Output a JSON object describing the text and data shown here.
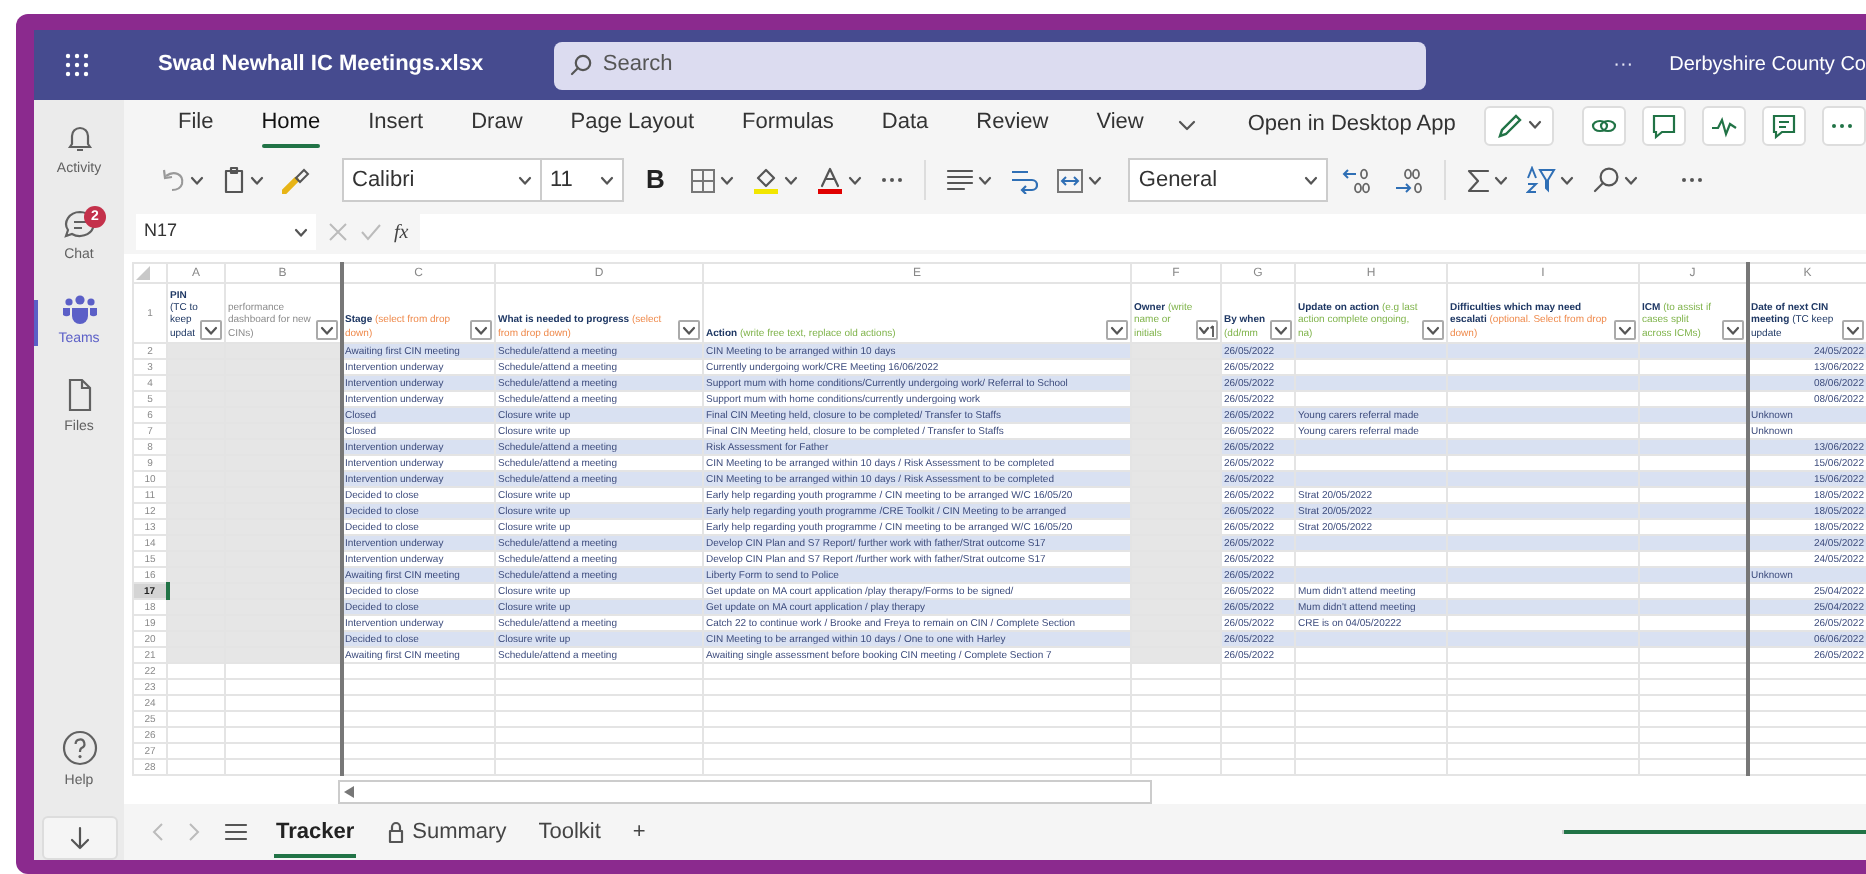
{
  "window": {
    "title": "Swad Newhall IC Meetings.xlsx",
    "search_placeholder": "Search",
    "more": "···",
    "organization": "Derbyshire County Co"
  },
  "rail": [
    {
      "label": "Activity",
      "selected": false
    },
    {
      "label": "Chat",
      "badge": "2",
      "selected": false
    },
    {
      "label": "Teams",
      "selected": true
    },
    {
      "label": "Files",
      "selected": false
    }
  ],
  "rail_bottom": [
    {
      "label": "Help"
    }
  ],
  "header_row": "1",
  "ribbon": {
    "tabs": [
      {
        "label": "File",
        "selected": false
      },
      {
        "label": "Home",
        "selected": true
      },
      {
        "label": "Insert",
        "selected": false
      },
      {
        "label": "Draw",
        "selected": false
      },
      {
        "label": "Page Layout",
        "selected": false
      },
      {
        "label": "Formulas",
        "selected": false
      },
      {
        "label": "Data",
        "selected": false
      },
      {
        "label": "Review",
        "selected": false
      },
      {
        "label": "View",
        "selected": false
      }
    ],
    "open_desktop": "Open in Desktop App",
    "font": "Calibri",
    "size": "11",
    "bold": "B",
    "number_format": "General"
  },
  "formula_bar": {
    "cell": "N17",
    "fx": "fx"
  },
  "columns": [
    {
      "letter": "A",
      "title": "PIN",
      "hint": "(TC to keep updat",
      "kind": "note",
      "sorted": false
    },
    {
      "letter": "B",
      "hint": "performance dashboard for new CINs)",
      "kind": "plain",
      "sorted": false
    },
    {
      "letter": "C",
      "title": "Stage",
      "hint": "(select from drop down)",
      "kind": "select",
      "sorted": false
    },
    {
      "letter": "D",
      "title": "What is needed to progress",
      "hint": "(select from drop down)",
      "kind": "select",
      "sorted": false
    },
    {
      "letter": "E",
      "title": "Action",
      "hint": "(write free text, replace old actions)",
      "kind": "write",
      "sorted": false
    },
    {
      "letter": "F",
      "title": "Owner",
      "hint": "(write name or initials",
      "kind": "write",
      "sorted": true
    },
    {
      "letter": "G",
      "title": "By when",
      "hint": "(dd/mm",
      "kind": "write",
      "sorted": false
    },
    {
      "letter": "H",
      "title": "Update on action",
      "hint": "(e.g last action complete ongoing, na)",
      "kind": "write",
      "sorted": false
    },
    {
      "letter": "I",
      "title": "Difficulties which may need escalati",
      "hint": "(optional. Select from drop down)",
      "kind": "select",
      "sorted": false
    },
    {
      "letter": "J",
      "title": "ICM",
      "hint": "(to assist if cases split across ICMs)",
      "kind": "write",
      "sorted": false
    },
    {
      "letter": "K",
      "title": "Date of next CIN meeting",
      "hint": "(TC keep update",
      "kind": "note",
      "sorted": false
    }
  ],
  "rows": [
    {
      "row": "2",
      "stage": "Awaiting first CIN meeting",
      "need": "Schedule/attend a meeting",
      "action": "CIN Meeting to be arranged within 10 days",
      "by_when": "26/05/2022",
      "next_meeting": {
        "text": "24/05/2022",
        "kind": "date"
      },
      "selected": false
    },
    {
      "row": "3",
      "stage": "Intervention underway",
      "need": "Schedule/attend a meeting",
      "action": "Currently undergoing work/CRE Meeting 16/06/2022",
      "by_when": "26/05/2022",
      "next_meeting": {
        "text": "13/06/2022",
        "kind": "date"
      },
      "selected": false
    },
    {
      "row": "4",
      "stage": "Intervention underway",
      "need": "Schedule/attend a meeting",
      "action": "Support mum with home conditions/Currently undergoing work/ Referral to School",
      "by_when": "26/05/2022",
      "next_meeting": {
        "text": "08/06/2022",
        "kind": "date"
      },
      "selected": false
    },
    {
      "row": "5",
      "stage": "Intervention underway",
      "need": "Schedule/attend a meeting",
      "action": "Support mum with home conditions/currently undergoing work",
      "by_when": "26/05/2022",
      "next_meeting": {
        "text": "08/06/2022",
        "kind": "date"
      },
      "selected": false
    },
    {
      "row": "6",
      "stage": "Closed",
      "need": "Closure write up",
      "action": "Final CIN Meeting held, closure to be completed/ Transfer to Staffs",
      "by_when": "26/05/2022",
      "update": "Young carers referral made",
      "next_meeting": {
        "text": "Unknown",
        "kind": "text"
      },
      "selected": false
    },
    {
      "row": "7",
      "stage": "Closed",
      "need": "Closure write up",
      "action": "Final CIN Meeting held, closure to be completed / Transfer to Staffs",
      "by_when": "26/05/2022",
      "update": "Young carers referral made",
      "next_meeting": {
        "text": "Unknown",
        "kind": "text"
      },
      "selected": false
    },
    {
      "row": "8",
      "stage": "Intervention underway",
      "need": "Schedule/attend a meeting",
      "action": "Risk Assessment for Father",
      "by_when": "26/05/2022",
      "next_meeting": {
        "text": "13/06/2022",
        "kind": "date"
      },
      "selected": false
    },
    {
      "row": "9",
      "stage": "Intervention underway",
      "need": "Schedule/attend a meeting",
      "action": "CIN Meeting to be arranged within 10 days / Risk Assessment to be completed",
      "by_when": "26/05/2022",
      "next_meeting": {
        "text": "15/06/2022",
        "kind": "date"
      },
      "selected": false
    },
    {
      "row": "10",
      "stage": "Intervention underway",
      "need": "Schedule/attend a meeting",
      "action": "CIN Meeting to be arranged within 10 days / Risk Assessment to be completed",
      "by_when": "26/05/2022",
      "next_meeting": {
        "text": "15/06/2022",
        "kind": "date"
      },
      "selected": false
    },
    {
      "row": "11",
      "stage": "Decided to close",
      "need": "Closure write up",
      "action": "Early help regarding youth programme / CIN meeting to be arranged W/C 16/05/20",
      "by_when": "26/05/2022",
      "update": "Strat 20/05/2022",
      "next_meeting": {
        "text": "18/05/2022",
        "kind": "date"
      },
      "selected": false
    },
    {
      "row": "12",
      "stage": "Decided to close",
      "need": "Closure write up",
      "action": "Early help regarding youth programme /CRE Toolkit / CIN Meeting to be arranged",
      "by_when": "26/05/2022",
      "update": "Strat 20/05/2022",
      "next_meeting": {
        "text": "18/05/2022",
        "kind": "date"
      },
      "selected": false
    },
    {
      "row": "13",
      "stage": "Decided to close",
      "need": "Closure write up",
      "action": "Early help regarding youth programme / CIN meeting to be arranged W/C 16/05/20",
      "by_when": "26/05/2022",
      "update": "Strat 20/05/2022",
      "next_meeting": {
        "text": "18/05/2022",
        "kind": "date"
      },
      "selected": false
    },
    {
      "row": "14",
      "stage": "Intervention underway",
      "need": "Schedule/attend a meeting",
      "action": "Develop CIN Plan and S7 Report/ further work with father/Strat outcome S17",
      "by_when": "26/05/2022",
      "next_meeting": {
        "text": "24/05/2022",
        "kind": "date"
      },
      "selected": false
    },
    {
      "row": "15",
      "stage": "Intervention underway",
      "need": "Schedule/attend a meeting",
      "action": "Develop CIN Plan and S7 Report /further work with father/Strat outcome S17",
      "by_when": "26/05/2022",
      "next_meeting": {
        "text": "24/05/2022",
        "kind": "date"
      },
      "selected": false
    },
    {
      "row": "16",
      "stage": "Awaiting first CIN meeting",
      "need": "Schedule/attend a meeting",
      "action": "Liberty Form to send to Police",
      "by_when": "26/05/2022",
      "next_meeting": {
        "text": "Unknown",
        "kind": "text"
      },
      "selected": false
    },
    {
      "row": "17",
      "stage": "Decided to close",
      "need": "Closure write up",
      "action": "Get update on MA court application /play therapy/Forms to be signed/",
      "by_when": "26/05/2022",
      "update": "Mum didn't attend meeting",
      "next_meeting": {
        "text": "25/04/2022",
        "kind": "date"
      },
      "selected": true
    },
    {
      "row": "18",
      "stage": "Decided to close",
      "need": "Closure write up",
      "action": "Get update on MA court application / play therapy",
      "by_when": "26/05/2022",
      "update": "Mum didn't attend meeting",
      "next_meeting": {
        "text": "25/04/2022",
        "kind": "date"
      },
      "selected": false
    },
    {
      "row": "19",
      "stage": "Intervention underway",
      "need": "Schedule/attend a meeting",
      "action": "Catch 22 to continue work / Brooke and Freya to remain on CIN / Complete Section",
      "by_when": "26/05/2022",
      "update": "CRE is on 04/05/20222",
      "next_meeting": {
        "text": "26/05/2022",
        "kind": "date"
      },
      "selected": false
    },
    {
      "row": "20",
      "stage": "Decided to close",
      "need": "Closure write up",
      "action": "CIN Meeting to be arranged within 10 days / One to one with Harley",
      "by_when": "26/05/2022",
      "next_meeting": {
        "text": "06/06/2022",
        "kind": "date"
      },
      "selected": false
    },
    {
      "row": "21",
      "stage": "Awaiting first CIN meeting",
      "need": "Schedule/attend a meeting",
      "action": "Awaiting single assessment before booking CIN meeting / Complete Section 7",
      "by_when": "26/05/2022",
      "next_meeting": {
        "text": "26/05/2022",
        "kind": "date"
      },
      "selected": false
    }
  ],
  "empty_rows": [
    "22",
    "23",
    "24",
    "25",
    "26",
    "27",
    "28"
  ],
  "sheets": [
    {
      "label": "Tracker",
      "selected": true,
      "locked": false
    },
    {
      "label": "Summary",
      "selected": false,
      "locked": true
    },
    {
      "label": "Toolkit",
      "selected": false,
      "locked": false
    }
  ],
  "add_sheet": "+"
}
